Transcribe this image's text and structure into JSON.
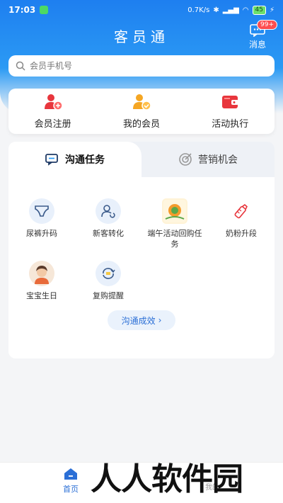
{
  "status_bar": {
    "time": "17:03",
    "network_speed": "0.7K/s",
    "battery": "45"
  },
  "header": {
    "title": "客员通",
    "messages_label": "消息",
    "messages_badge": "99+"
  },
  "search": {
    "placeholder": "会员手机号"
  },
  "quick_actions": [
    {
      "label": "会员注册",
      "icon": "user-add-icon"
    },
    {
      "label": "我的会员",
      "icon": "user-check-icon"
    },
    {
      "label": "活动执行",
      "icon": "wallet-icon"
    }
  ],
  "tabs": [
    {
      "label": "沟通任务",
      "icon": "chat-icon",
      "active": true
    },
    {
      "label": "营销机会",
      "icon": "target-icon",
      "active": false
    }
  ],
  "tasks": [
    {
      "label": "尿裤升码",
      "icon": "diaper-icon"
    },
    {
      "label": "新客转化",
      "icon": "user-refresh-icon"
    },
    {
      "label": "端午活动回购任务",
      "icon": "dragon-boat-image"
    },
    {
      "label": "奶粉升段",
      "icon": "baby-bottle-icon"
    },
    {
      "label": "宝宝生日",
      "icon": "baby-avatar-icon"
    },
    {
      "label": "复购提醒",
      "icon": "repeat-icon"
    }
  ],
  "effect_button": "沟通成效",
  "bottom_nav": {
    "home_label": "首页",
    "other_label": "我的"
  },
  "watermark": "人人软件园",
  "colors": {
    "primary": "#1e7ff0",
    "accent_red": "#ff4d4f",
    "accent_orange": "#f5a623"
  }
}
